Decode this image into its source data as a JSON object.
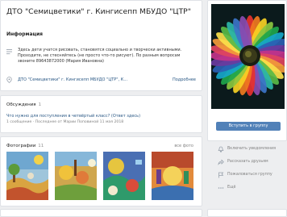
{
  "group": {
    "title": "ДТО \"Семицветики\" г. Кингисепп МБУДО \"ЦТР\""
  },
  "info": {
    "section_label": "Информация",
    "description": "Здесь дети учатся рисовать, становятся социально и творчески активными. Проходите, не стесняйтесь (не просто что-то рисуют). По разным вопросам звоните 89643872000 (Мария Ивановна)",
    "link_text": "ДТО \"Семицветики\" г. Кингисепп МБУДО \"ЦТР\", К...",
    "more_label": "Подробнее"
  },
  "discussions": {
    "label": "Обсуждения",
    "count": "1",
    "topic": "Что нужно для поступления в четвёртый класс? (Ответ здесь)",
    "meta": "1 сообщение · Последнее от Марии Поповиной 11 мая 2018"
  },
  "photos": {
    "label": "Фотографии",
    "count": "11",
    "all_label": "все фото"
  },
  "sidebar": {
    "join_button": "Вступить в группу",
    "actions": [
      "Включить уведомления",
      "Рассказать друзьям",
      "Пожаловаться группу",
      "Ещё"
    ]
  },
  "colors": {
    "accent": "#5181b8",
    "link": "#2a5885",
    "background": "#edeef0"
  }
}
